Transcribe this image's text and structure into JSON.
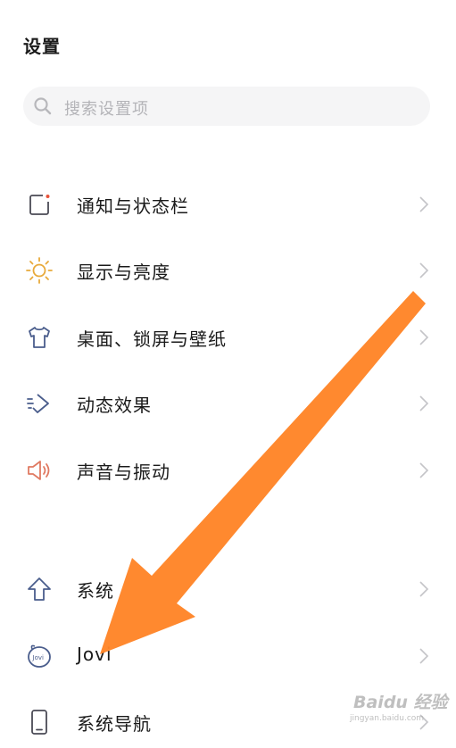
{
  "header": {
    "title": "设置"
  },
  "search": {
    "placeholder": "搜索设置项"
  },
  "items": [
    {
      "label": "通知与状态栏",
      "icon": "notification-icon"
    },
    {
      "label": "显示与亮度",
      "icon": "sun-icon"
    },
    {
      "label": "桌面、锁屏与壁纸",
      "icon": "shirt-icon"
    },
    {
      "label": "动态效果",
      "icon": "motion-effect-icon"
    },
    {
      "label": "声音与振动",
      "icon": "speaker-icon"
    },
    {
      "label": "系统",
      "icon": "arrow-up-icon"
    },
    {
      "label": "Jovi",
      "icon": "jovi-icon"
    },
    {
      "label": "系统导航",
      "icon": "phone-icon"
    }
  ],
  "watermark": {
    "brand": "Baidu 经验",
    "url": "jingyan.baidu.com"
  },
  "colors": {
    "text": "#1a1a1a",
    "search_bg": "#f5f5f6",
    "placeholder": "#b4b4b8",
    "chevron": "#c4c4c8",
    "arrow_annotation": "#ff8427",
    "notification_dot": "#e8533b",
    "sun": "#e8a93a",
    "speaker": "#e07a62",
    "icon_blue": "#4a5d8c"
  }
}
